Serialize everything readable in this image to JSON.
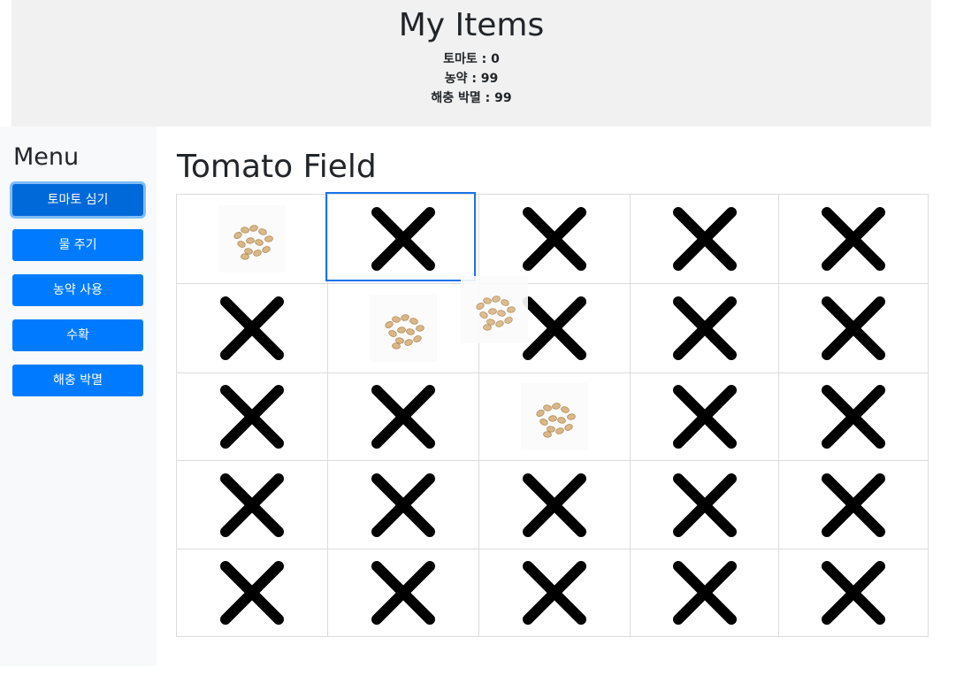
{
  "header": {
    "title": "My Items",
    "items": [
      {
        "label": "토마토 : 0"
      },
      {
        "label": "농약 : 99"
      },
      {
        "label": "해충 박멸 : 99"
      }
    ]
  },
  "sidebar": {
    "title": "Menu",
    "buttons": [
      {
        "label": "토마토 심기",
        "active": true
      },
      {
        "label": "물 주기",
        "active": false
      },
      {
        "label": "농약 사용",
        "active": false
      },
      {
        "label": "수확",
        "active": false
      },
      {
        "label": "해충 박멸",
        "active": false
      }
    ]
  },
  "field": {
    "title": "Tomato Field",
    "rows": [
      [
        "seed",
        "x",
        "x",
        "x",
        "x"
      ],
      [
        "x",
        "seed",
        "x",
        "x",
        "x"
      ],
      [
        "x",
        "x",
        "seed",
        "x",
        "x"
      ],
      [
        "x",
        "x",
        "x",
        "x",
        "x"
      ],
      [
        "x",
        "x",
        "x",
        "x",
        "x"
      ]
    ],
    "selected_cell": {
      "row": 1,
      "col": 2
    },
    "dragging_item": "seed"
  },
  "icons": {
    "x": "x-icon",
    "seed": "tomato-seeds-icon"
  },
  "colors": {
    "primary": "#007bff",
    "primary_active": "#0069d9",
    "focus_ring": "#80bdff",
    "selection_outline": "#1a73e8"
  }
}
